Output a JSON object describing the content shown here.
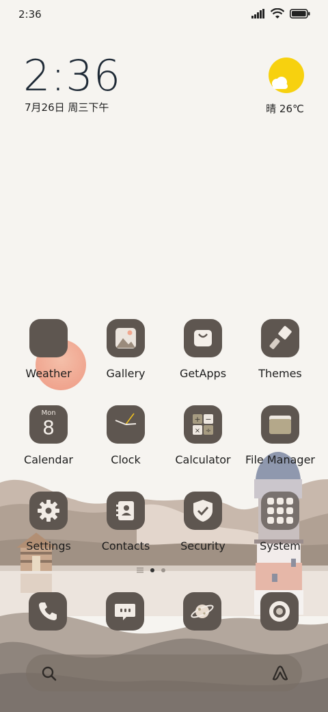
{
  "status": {
    "time": "2:36"
  },
  "widget": {
    "clock": "2:36",
    "date": "7月26日 周三下午",
    "weather_temp": "晴 26℃"
  },
  "apps": [
    {
      "label": "Weather"
    },
    {
      "label": "Gallery"
    },
    {
      "label": "GetApps"
    },
    {
      "label": "Themes"
    },
    {
      "label": "Calendar",
      "badge_day": "Mon",
      "badge_date": "8"
    },
    {
      "label": "Clock"
    },
    {
      "label": "Calculator"
    },
    {
      "label": "File Manager"
    },
    {
      "label": "Settings"
    },
    {
      "label": "Contacts"
    },
    {
      "label": "Security"
    },
    {
      "label": "System"
    }
  ],
  "dock": [
    {
      "icon": "phone-icon"
    },
    {
      "icon": "messages-icon"
    },
    {
      "icon": "browser-planet-icon"
    },
    {
      "icon": "camera-icon"
    }
  ],
  "page_indicator": {
    "current": 1,
    "total": 2
  },
  "colors": {
    "tile": "#5e5650",
    "background": "#f6f4f0",
    "sun": "#f7d10f"
  }
}
